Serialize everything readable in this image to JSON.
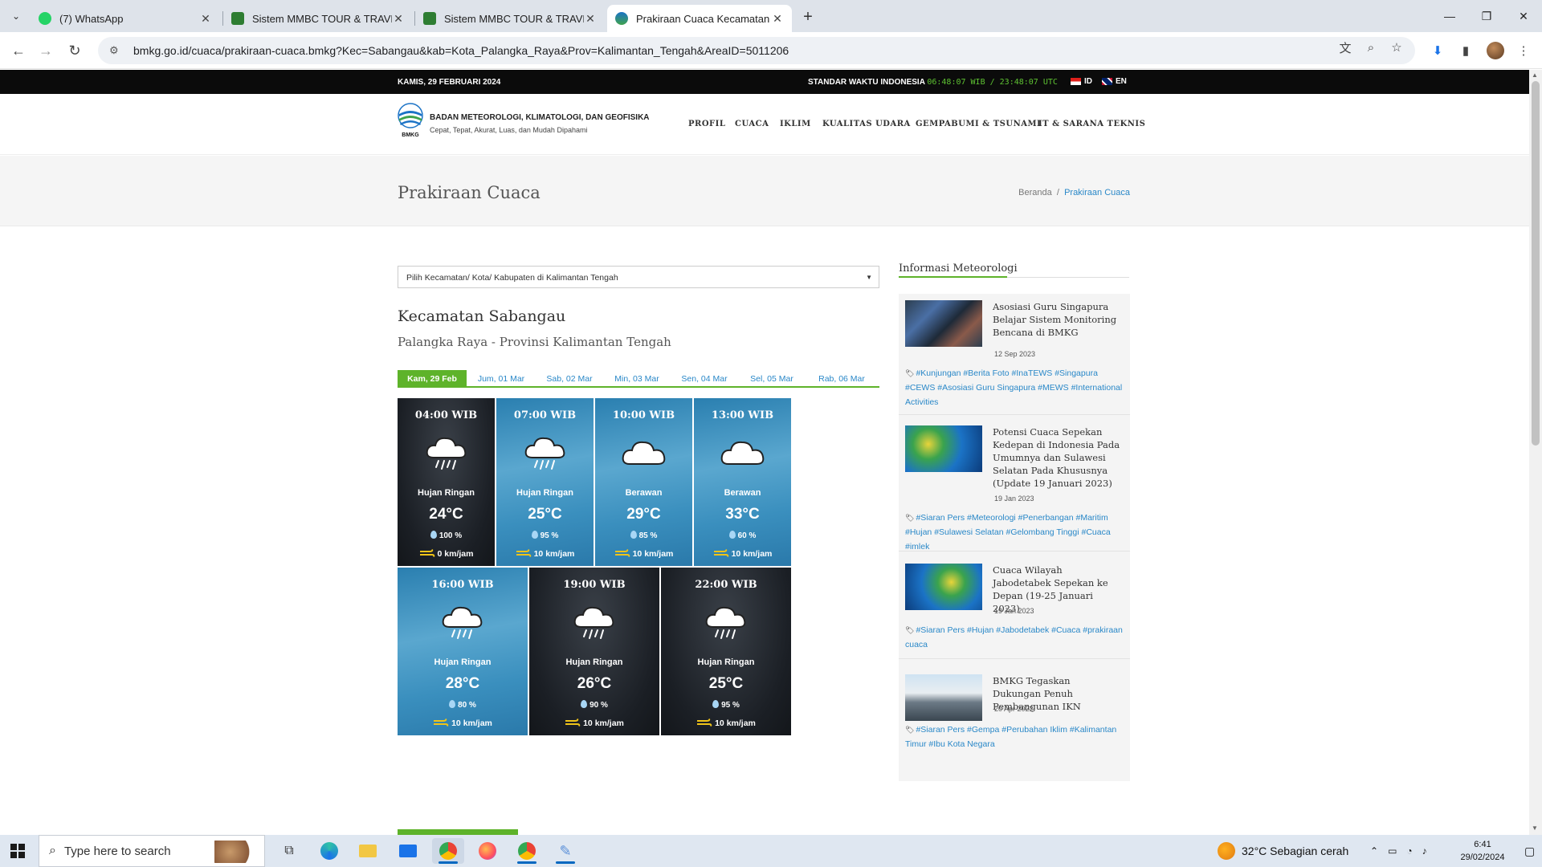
{
  "browser": {
    "tabs": [
      {
        "title": "(7) WhatsApp",
        "color": "#25d366"
      },
      {
        "title": "Sistem MMBC TOUR & TRAVEL",
        "color": "#2e7d32"
      },
      {
        "title": "Sistem MMBC TOUR & TRAVEL",
        "color": "#2e7d32"
      },
      {
        "title": "Prakiraan Cuaca Kecamatan Sab",
        "color": "#1b73c6"
      }
    ],
    "url": "bmkg.go.id/cuaca/prakiraan-cuaca.bmkg?Kec=Sabangau&kab=Kota_Palangka_Raya&Prov=Kalimantan_Tengah&AreaID=5011206"
  },
  "topbar": {
    "date": "KAMIS, 29 FEBRUARI 2024",
    "std_label": "STANDAR WAKTU INDONESIA",
    "clock": "06:48:07 WIB / 23:48:07 UTC",
    "lang_id": "ID",
    "lang_en": "EN"
  },
  "header": {
    "logo_text": "BMKG",
    "org_name": "BADAN METEOROLOGI, KLIMATOLOGI, DAN GEOFISIKA",
    "tagline": "Cepat, Tepat, Akurat, Luas, dan Mudah Dipahami",
    "nav": [
      "PROFIL",
      "CUACA",
      "IKLIM",
      "KUALITAS UDARA",
      "GEMPABUMI & TSUNAMI",
      "IT & SARANA TEKNIS"
    ]
  },
  "titlebar": {
    "title": "Prakiraan Cuaca",
    "crumb_home": "Beranda",
    "crumb_sep": "/",
    "crumb_current": "Prakiraan Cuaca"
  },
  "main": {
    "select_placeholder": "Pilih Kecamatan/ Kota/ Kabupaten di Kalimantan Tengah",
    "kecamatan": "Kecamatan Sabangau",
    "province": "Palangka Raya - Provinsi Kalimantan Tengah",
    "day_tabs": [
      "Kam, 29 Feb",
      "Jum, 01 Mar",
      "Sab, 02 Mar",
      "Min, 03 Mar",
      "Sen, 04 Mar",
      "Sel, 05 Mar",
      "Rab, 06 Mar"
    ],
    "forecasts": [
      {
        "time": "04:00 WIB",
        "cond": "Hujan Ringan",
        "temp": "24°C",
        "hum": "100 %",
        "wind": "0 km/jam",
        "dir": "CALM",
        "theme": "dark",
        "icon": "rain-cloud-icon"
      },
      {
        "time": "07:00 WIB",
        "cond": "Hujan Ringan",
        "temp": "25°C",
        "hum": "95 %",
        "wind": "10 km/jam",
        "dir": "Timur Laut",
        "theme": "blue",
        "icon": "rain-cloud-icon"
      },
      {
        "time": "10:00 WIB",
        "cond": "Berawan",
        "temp": "29°C",
        "hum": "85 %",
        "wind": "10 km/jam",
        "dir": "Timur Laut",
        "theme": "blue",
        "icon": "cloud-icon"
      },
      {
        "time": "13:00 WIB",
        "cond": "Berawan",
        "temp": "33°C",
        "hum": "60 %",
        "wind": "10 km/jam",
        "dir": "Timur",
        "theme": "blue",
        "icon": "cloud-icon"
      },
      {
        "time": "16:00 WIB",
        "cond": "Hujan Ringan",
        "temp": "28°C",
        "hum": "80 %",
        "wind": "10 km/jam",
        "dir": "Timur Laut",
        "theme": "blue",
        "icon": "rain-cloud-icon"
      },
      {
        "time": "19:00 WIB",
        "cond": "Hujan Ringan",
        "temp": "26°C",
        "hum": "90 %",
        "wind": "10 km/jam",
        "dir": "Timur Laut",
        "theme": "dark",
        "icon": "rain-cloud-icon"
      },
      {
        "time": "22:00 WIB",
        "cond": "Hujan Ringan",
        "temp": "25°C",
        "hum": "95 %",
        "wind": "10 km/jam",
        "dir": "Timur Laut",
        "theme": "dark",
        "icon": "rain-cloud-icon"
      }
    ]
  },
  "sidebar": {
    "title": "Informasi Meteorologi",
    "news": [
      {
        "title": "Asosiasi Guru Singapura Belajar Sistem Monitoring Bencana di BMKG",
        "date": "12 Sep 2023",
        "tags": "#Kunjungan #Berita Foto #InaTEWS #Singapura #CEWS #Asosiasi Guru Singapura #MEWS #International Activities"
      },
      {
        "title": "Potensi Cuaca Sepekan Kedepan di Indonesia Pada Umumnya dan Sulawesi Selatan Pada Khususnya (Update 19 Januari 2023)",
        "date": "19 Jan 2023",
        "tags": "#Siaran Pers #Meteorologi #Penerbangan #Maritim #Hujan #Sulawesi Selatan #Gelombang Tinggi #Cuaca #imlek"
      },
      {
        "title": "Cuaca Wilayah Jabodetabek Sepekan ke Depan (19-25 Januari 2023)",
        "date": "19 Jan 2023",
        "tags": "#Siaran Pers #Hujan #Jabodetabek #Cuaca #prakiraan cuaca"
      },
      {
        "title": "BMKG Tegaskan Dukungan Penuh Pembangunan IKN",
        "date": "20 Apr 2022",
        "tags": "#Siaran Pers #Gempa #Perubahan Iklim #Kalimantan Timur #Ibu Kota Negara"
      }
    ]
  },
  "taskbar": {
    "search_placeholder": "Type here to search",
    "weather": "32°C  Sebagian cerah",
    "time": "6:41",
    "date": "29/02/2024"
  }
}
